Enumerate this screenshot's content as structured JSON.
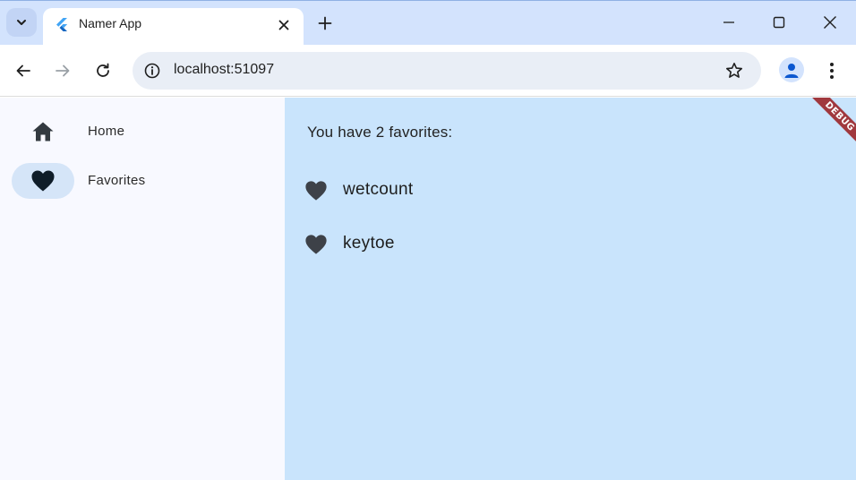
{
  "browser": {
    "tab": {
      "title": "Namer App",
      "favicon": "flutter-logo-icon"
    },
    "url": "localhost:51097",
    "icons": {
      "tab_search": "chevron-down-icon",
      "close_tab": "close-icon",
      "new_tab": "plus-icon",
      "minimize": "minimize-icon",
      "maximize": "maximize-icon",
      "close_window": "close-icon",
      "back": "arrow-left-icon",
      "forward": "arrow-right-icon",
      "reload": "reload-icon",
      "site_info": "info-icon",
      "bookmark": "star-icon",
      "profile": "person-icon",
      "menu": "kebab-menu-icon"
    },
    "colors": {
      "tabstrip": "#d3e3fd",
      "omnibox": "#e9eef6"
    }
  },
  "app": {
    "nav": [
      {
        "label": "Home",
        "icon": "home-icon",
        "selected": false
      },
      {
        "label": "Favorites",
        "icon": "heart-icon",
        "selected": true
      }
    ],
    "summary": "You have 2 favorites:",
    "favorites": [
      {
        "text": "wetcount",
        "icon": "heart-icon"
      },
      {
        "text": "keytoe",
        "icon": "heart-icon"
      }
    ],
    "debug_banner": "DEBUG",
    "colors": {
      "rail_bg": "#f8f9ff",
      "main_bg": "#c9e4fc",
      "selected_indicator": "#d5e5f8",
      "debug_banner": "#a0383e"
    }
  }
}
